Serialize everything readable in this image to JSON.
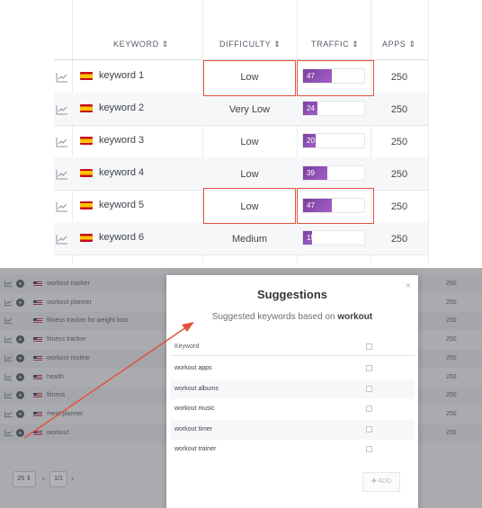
{
  "top_table": {
    "headers": {
      "keyword": "KEYWORD ⇕",
      "difficulty": "DIFFICULTY ⇕",
      "traffic": "TRAFFIC ⇕",
      "apps": "APPS ⇕"
    },
    "rows": [
      {
        "keyword": "keyword 1",
        "difficulty": "Low",
        "traffic": "47",
        "traffic_pct": 47,
        "apps": "250"
      },
      {
        "keyword": "keyword 2",
        "difficulty": "Very Low",
        "traffic": "24",
        "traffic_pct": 24,
        "apps": "250"
      },
      {
        "keyword": "keyword 3",
        "difficulty": "Low",
        "traffic": "20",
        "traffic_pct": 20,
        "apps": "250"
      },
      {
        "keyword": "keyword 4",
        "difficulty": "Low",
        "traffic": "39",
        "traffic_pct": 39,
        "apps": "250"
      },
      {
        "keyword": "keyword 5",
        "difficulty": "Low",
        "traffic": "47",
        "traffic_pct": 47,
        "apps": "250"
      },
      {
        "keyword": "keyword 6",
        "difficulty": "Medium",
        "traffic": "15",
        "traffic_pct": 15,
        "apps": "250"
      }
    ],
    "highlight_color": "#e2533d",
    "traffic_color": "#8a47b0"
  },
  "bottom_table": {
    "rows": [
      {
        "keyword": "workout tracker",
        "apps": "250"
      },
      {
        "keyword": "workout planner",
        "apps": "250"
      },
      {
        "keyword": "fitness tracker for weight loss",
        "apps": "250"
      },
      {
        "keyword": "fitness tracker",
        "apps": "250"
      },
      {
        "keyword": "workout routine",
        "apps": "250"
      },
      {
        "keyword": "health",
        "apps": "250"
      },
      {
        "keyword": "fitness",
        "apps": "250"
      },
      {
        "keyword": "meal planner",
        "apps": "250"
      },
      {
        "keyword": "workout",
        "apps": "250"
      }
    ],
    "per_page": "25 ⇕",
    "prev": "‹",
    "page": "1/1",
    "next": "›"
  },
  "modal": {
    "close": "×",
    "title": "Suggestions",
    "subtitle_prefix": "Suggested keywords based on",
    "subtitle_term": "workout",
    "column_header": "Keyword",
    "suggestions": [
      "workout apps",
      "workout albums",
      "workout music",
      "workout timer",
      "workout trainer"
    ],
    "add_label": "✚ ADD"
  }
}
